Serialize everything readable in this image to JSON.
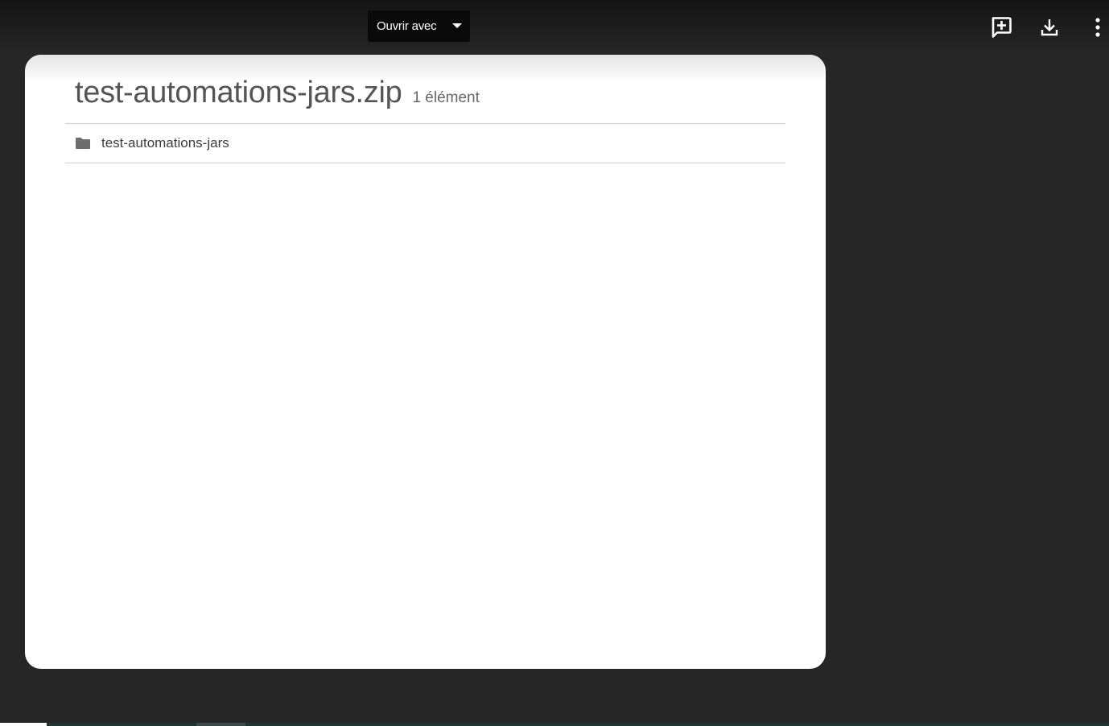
{
  "toolbar": {
    "open_with_label": "Ouvrir avec",
    "icons": [
      "add-comment-icon",
      "download-icon",
      "more-vertical-icon"
    ]
  },
  "archive": {
    "title": "test-automations-jars.zip",
    "item_count": "1 élément",
    "items": [
      {
        "name": "test-automations-jars",
        "icon": "folder-icon"
      }
    ]
  },
  "colors": {
    "background": "#262626",
    "button_bg": "#0a0a0a",
    "card_bg": "#ffffff",
    "title_text": "#555555",
    "folder_icon": "#6e6e6e"
  }
}
